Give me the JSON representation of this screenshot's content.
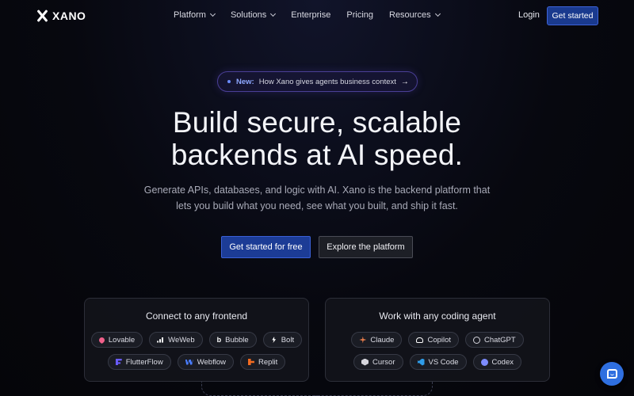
{
  "nav": {
    "logo": "XANO",
    "links": [
      {
        "label": "Platform",
        "dropdown": true
      },
      {
        "label": "Solutions",
        "dropdown": true
      },
      {
        "label": "Enterprise",
        "dropdown": false
      },
      {
        "label": "Pricing",
        "dropdown": false
      },
      {
        "label": "Resources",
        "dropdown": true
      }
    ],
    "login": "Login",
    "cta": "Get started"
  },
  "announcement": {
    "tag": "New:",
    "text": "How Xano gives agents business context",
    "arrow": "→"
  },
  "hero": {
    "title_line1": "Build secure, scalable",
    "title_line2": "backends at AI speed.",
    "sub_line1": "Generate APIs, databases, and logic with AI. Xano is the backend platform that",
    "sub_line2": "lets you build what you need, see what you built, and ship it fast.",
    "primary_cta": "Get started for free",
    "secondary_cta": "Explore the platform"
  },
  "cards": {
    "frontend": {
      "title": "Connect to any frontend",
      "row1": [
        {
          "label": "Lovable",
          "icon": "lovable-icon"
        },
        {
          "label": "WeWeb",
          "icon": "weweb-icon"
        },
        {
          "label": "Bubble",
          "icon": "bubble-icon"
        },
        {
          "label": "Bolt",
          "icon": "bolt-icon"
        }
      ],
      "row2": [
        {
          "label": "FlutterFlow",
          "icon": "flutterflow-icon"
        },
        {
          "label": "Webflow",
          "icon": "webflow-icon"
        },
        {
          "label": "Replit",
          "icon": "replit-icon"
        }
      ]
    },
    "agent": {
      "title": "Work with any coding agent",
      "row1": [
        {
          "label": "Claude",
          "icon": "claude-icon"
        },
        {
          "label": "Copilot",
          "icon": "copilot-icon"
        },
        {
          "label": "ChatGPT",
          "icon": "chatgpt-icon"
        }
      ],
      "row2": [
        {
          "label": "Cursor",
          "icon": "cursor-icon"
        },
        {
          "label": "VS Code",
          "icon": "vscode-icon"
        },
        {
          "label": "Codex",
          "icon": "codex-icon"
        }
      ]
    }
  },
  "colors": {
    "accent": "#1c3c96",
    "accent_border": "#3a60d6",
    "background": "#07080f",
    "pill_border": "#4a3f96",
    "chat": "#2f6fe0"
  }
}
